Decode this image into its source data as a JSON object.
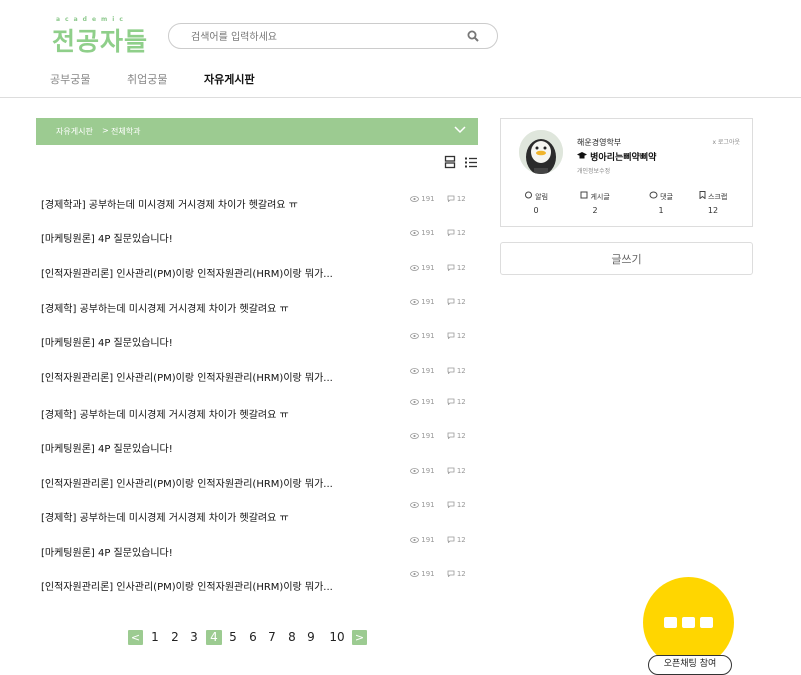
{
  "logo": {
    "small": "academic",
    "big": "전공자들"
  },
  "search": {
    "placeholder": "검색어를 입력하세요"
  },
  "nav": [
    {
      "label": "공부궁물",
      "active": false
    },
    {
      "label": "취업궁물",
      "active": false
    },
    {
      "label": "자유게시판",
      "active": true
    }
  ],
  "breadcrumb": {
    "board": "자유게시판",
    "separator": ">",
    "category": "전체학과"
  },
  "posts": [
    {
      "title": "[경제학과] 공부하는데 미시경제 거시경제 차이가 헷갈려요 ㅠ",
      "views": "191",
      "comments": "12"
    },
    {
      "title": "[마케팅원론] 4P 질문있습니다!",
      "views": "191",
      "comments": "12"
    },
    {
      "title": "[인적자원관리론] 인사관리(PM)이랑 인적자원관리(HRM)이랑 뭐가...",
      "views": "191",
      "comments": "12"
    },
    {
      "title": "[경제학] 공부하는데 미시경제 거시경제 차이가 헷갈려요 ㅠ",
      "views": "191",
      "comments": "12"
    },
    {
      "title": "[마케팅원론] 4P 질문있습니다!",
      "views": "191",
      "comments": "12"
    },
    {
      "title": "[인적자원관리론] 인사관리(PM)이랑 인적자원관리(HRM)이랑 뭐가...",
      "views": "191",
      "comments": "12"
    },
    {
      "title": "[경제학] 공부하는데 미시경제 거시경제 차이가 헷갈려요 ㅠ",
      "views": "191",
      "comments": "12"
    },
    {
      "title": "[마케팅원론] 4P 질문있습니다!",
      "views": "191",
      "comments": "12"
    },
    {
      "title": "[인적자원관리론] 인사관리(PM)이랑 인적자원관리(HRM)이랑 뭐가...",
      "views": "191",
      "comments": "12"
    },
    {
      "title": "[경제학] 공부하는데 미시경제 거시경제 차이가 헷갈려요 ㅠ",
      "views": "191",
      "comments": "12"
    },
    {
      "title": "[마케팅원론] 4P 질문있습니다!",
      "views": "191",
      "comments": "12"
    },
    {
      "title": "[인적자원관리론] 인사관리(PM)이랑 인적자원관리(HRM)이랑 뭐가...",
      "views": "191",
      "comments": "12"
    }
  ],
  "pagination": {
    "prev": "<",
    "next": ">",
    "pages": [
      "1",
      "2",
      "3",
      "4",
      "5",
      "6",
      "7",
      "8",
      "9",
      "10"
    ],
    "current": "4"
  },
  "profile": {
    "department": "해운경영학부",
    "nickname": "병아리는삐약삐약",
    "edit_label": "개인정보수정",
    "logout_label": "x 로그아웃",
    "stats": [
      {
        "label": "알림",
        "value": "0",
        "icon": "bell-icon"
      },
      {
        "label": "게시글",
        "value": "2",
        "icon": "post-icon"
      },
      {
        "label": "댓글",
        "value": "1",
        "icon": "comment-icon"
      },
      {
        "label": "스크랩",
        "value": "12",
        "icon": "bookmark-icon"
      }
    ]
  },
  "write_button": "글쓰기",
  "chat": {
    "label": "오픈채팅 참여"
  },
  "colors": {
    "accent": "#9ccb91",
    "logo": "#8fcf8a",
    "chat": "#ffd600"
  }
}
